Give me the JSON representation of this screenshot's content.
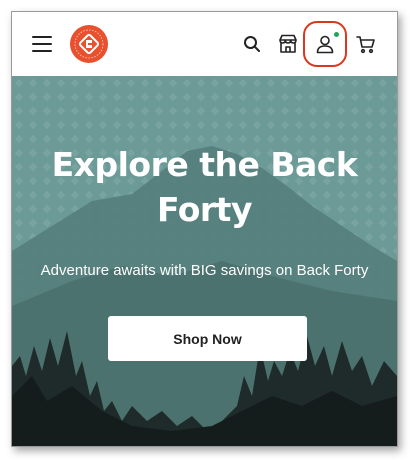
{
  "header": {
    "logo_alt": "Sierra logo",
    "icons": [
      "menu-icon",
      "search-icon",
      "store-icon",
      "account-icon",
      "cart-icon"
    ]
  },
  "hero": {
    "title": "Explore the Back Forty",
    "subtitle": "Adventure awaits with BIG savings on Back Forty",
    "cta_label": "Shop Now"
  },
  "colors": {
    "logo": "#e8502e",
    "hero_bg": "#6c9b98",
    "highlight": "#d9381e",
    "online": "#27a35a"
  }
}
